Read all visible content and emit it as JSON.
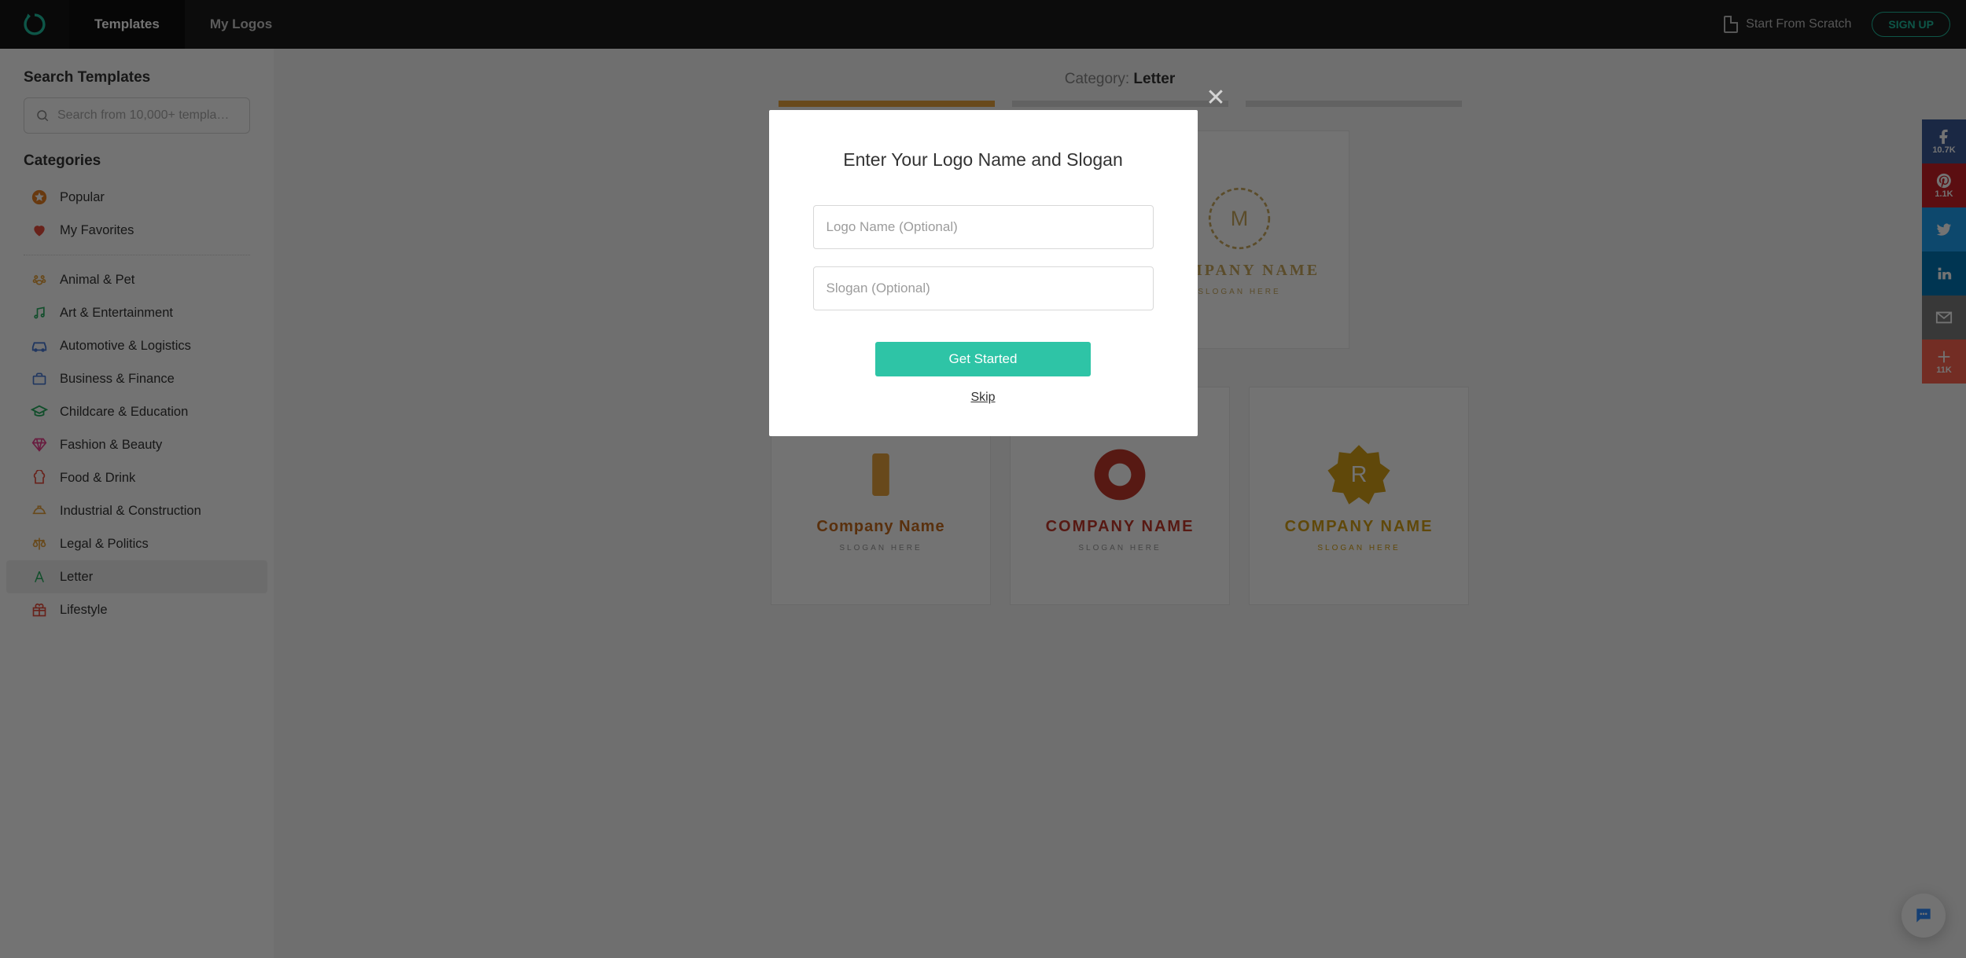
{
  "nav": {
    "tabs": {
      "templates": "Templates",
      "my_logos": "My Logos"
    },
    "scratch": "Start From Scratch",
    "signup": "SIGN UP"
  },
  "sidebar": {
    "search_title": "Search Templates",
    "search_placeholder": "Search from 10,000+ templa…",
    "categories_title": "Categories",
    "top": [
      {
        "label": "Popular",
        "icon": "star-icon",
        "color": "#e67e22"
      },
      {
        "label": "My Favorites",
        "icon": "heart-icon",
        "color": "#e74c3c"
      }
    ],
    "items": [
      {
        "label": "Animal & Pet",
        "icon": "paw-icon",
        "color": "#e6a23c"
      },
      {
        "label": "Art & Entertainment",
        "icon": "music-icon",
        "color": "#27ae60"
      },
      {
        "label": "Automotive & Logistics",
        "icon": "car-icon",
        "color": "#4a7bd6"
      },
      {
        "label": "Business & Finance",
        "icon": "briefcase-icon",
        "color": "#4a7bd6"
      },
      {
        "label": "Childcare & Education",
        "icon": "graduation-icon",
        "color": "#27ae60"
      },
      {
        "label": "Fashion & Beauty",
        "icon": "diamond-icon",
        "color": "#e83e8c"
      },
      {
        "label": "Food & Drink",
        "icon": "chef-icon",
        "color": "#e74c3c"
      },
      {
        "label": "Industrial & Construction",
        "icon": "hardhat-icon",
        "color": "#e6a23c"
      },
      {
        "label": "Legal & Politics",
        "icon": "scales-icon",
        "color": "#e6a23c"
      },
      {
        "label": "Letter",
        "icon": "letter-icon",
        "color": "#27ae60",
        "selected": true
      },
      {
        "label": "Lifestyle",
        "icon": "gift-icon",
        "color": "#e74c3c"
      }
    ]
  },
  "main": {
    "category_prefix": "Category: ",
    "category": "Letter",
    "cards": [
      {
        "company": "COMPANY NAME",
        "slogan": "SLOGAN HERE",
        "accent": "#c9a95e",
        "bg": "light"
      },
      {
        "company": "Company Name",
        "slogan": "SLOGAN HERE",
        "accent": "#e6a23c",
        "bg": "light"
      },
      {
        "company": "COMPANY NAME",
        "slogan": "SLOGAN HERE",
        "accent": "#c0392b",
        "bg": "light"
      },
      {
        "company": "COMPANY NAME",
        "slogan": "SLOGAN HERE",
        "accent": "#d4a017",
        "bg": "light"
      }
    ]
  },
  "share": {
    "fb": "10.7K",
    "pt": "1.1K",
    "plus": "11K"
  },
  "modal": {
    "title": "Enter Your Logo Name and Slogan",
    "logo_placeholder": "Logo Name (Optional)",
    "slogan_placeholder": "Slogan (Optional)",
    "cta": "Get Started",
    "skip": "Skip"
  }
}
